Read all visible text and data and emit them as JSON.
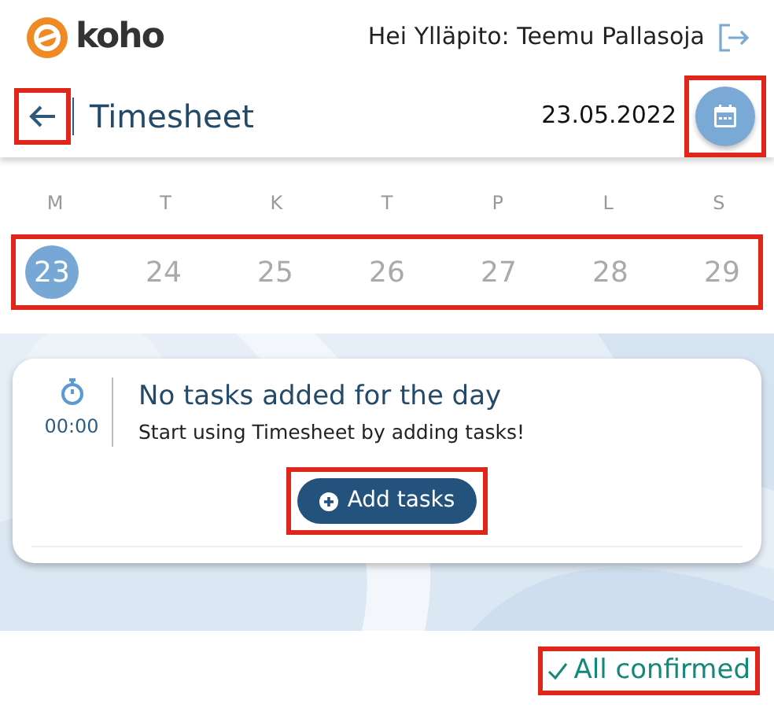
{
  "header": {
    "logo_text": "koho",
    "greeting": "Hei Ylläpito: Teemu Pallasoja"
  },
  "title_bar": {
    "back_highlighted": true,
    "title": "Timesheet",
    "date": "23.05.2022",
    "calendar_highlighted": true
  },
  "week": {
    "highlighted": true,
    "days": [
      {
        "weekday": "M",
        "date": "23",
        "selected": true
      },
      {
        "weekday": "T",
        "date": "24",
        "selected": false
      },
      {
        "weekday": "K",
        "date": "25",
        "selected": false
      },
      {
        "weekday": "T",
        "date": "26",
        "selected": false
      },
      {
        "weekday": "P",
        "date": "27",
        "selected": false
      },
      {
        "weekday": "L",
        "date": "28",
        "selected": false
      },
      {
        "weekday": "S",
        "date": "29",
        "selected": false
      }
    ]
  },
  "day_card": {
    "duration": "00:00",
    "heading": "No tasks added for the day",
    "message": "Start using Timesheet by adding tasks!",
    "add_button": {
      "label": "Add tasks",
      "highlighted": true
    }
  },
  "footer": {
    "status": "All confirmed",
    "highlighted": true
  }
}
